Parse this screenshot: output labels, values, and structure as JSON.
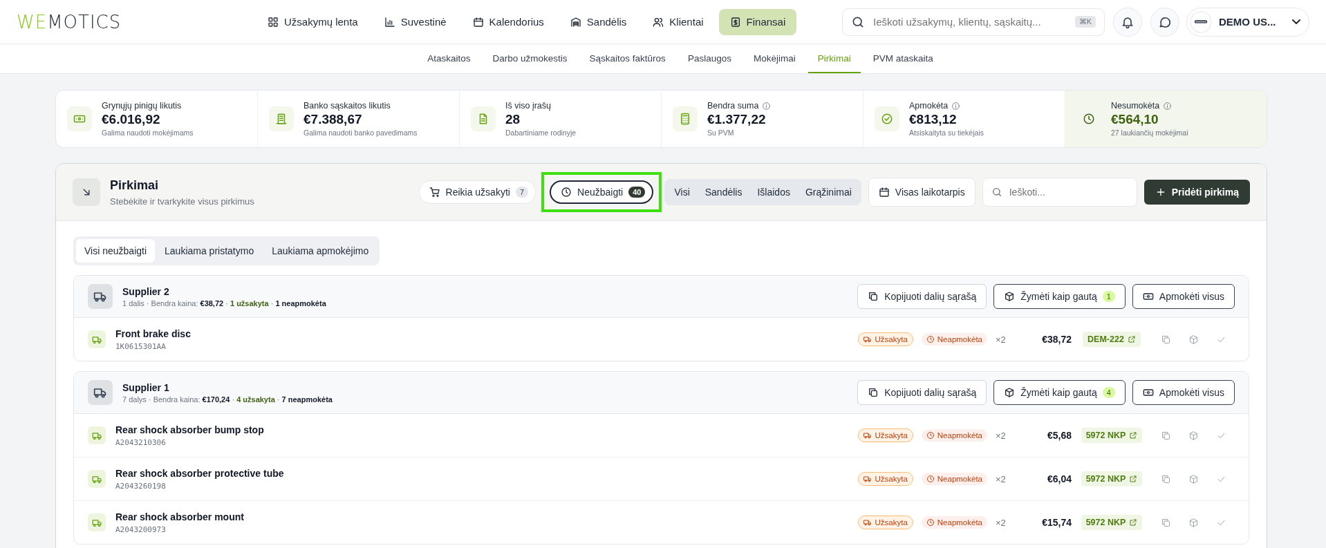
{
  "logo": {
    "accent": "WE",
    "rest": "MOTICS"
  },
  "nav": [
    {
      "label": "Užsakymų lenta",
      "selected": false
    },
    {
      "label": "Suvestinė",
      "selected": false
    },
    {
      "label": "Kalendorius",
      "selected": false
    },
    {
      "label": "Sandėlis",
      "selected": false
    },
    {
      "label": "Klientai",
      "selected": false
    },
    {
      "label": "Finansai",
      "selected": true
    }
  ],
  "search": {
    "placeholder": "Ieškoti užsakymų, klientų, sąskaitų...",
    "shortcut": "⌘K"
  },
  "user": {
    "name": "DEMO US..."
  },
  "subnav": [
    {
      "label": "Ataskaitos",
      "selected": false
    },
    {
      "label": "Darbo užmokestis",
      "selected": false
    },
    {
      "label": "Sąskaitos faktūros",
      "selected": false
    },
    {
      "label": "Paslaugos",
      "selected": false
    },
    {
      "label": "Mokėjimai",
      "selected": false
    },
    {
      "label": "Pirkimai",
      "selected": true
    },
    {
      "label": "PVM ataskaita",
      "selected": false
    }
  ],
  "stats": [
    {
      "label": "Grynųjų pinigų likutis",
      "info": false,
      "value": "€6.016,92",
      "note": "Galima naudoti mokėjimams",
      "accent": false
    },
    {
      "label": "Banko sąskaitos likutis",
      "info": false,
      "value": "€7.388,67",
      "note": "Galima naudoti banko pavedimams",
      "accent": false
    },
    {
      "label": "Iš viso įrašų",
      "info": false,
      "value": "28",
      "note": "Dabartiniame rodinyje",
      "accent": false
    },
    {
      "label": "Bendra suma",
      "info": true,
      "value": "€1.377,22",
      "note": "Su PVM",
      "accent": false
    },
    {
      "label": "Apmokėta",
      "info": true,
      "value": "€813,12",
      "note": "Atsiskaityta su tiekėjais",
      "accent": false
    },
    {
      "label": "Nesumokėta",
      "info": true,
      "value": "€564,10",
      "note": "27 laukiančių mokėjimai",
      "accent": true
    }
  ],
  "panel": {
    "title": "Pirkimai",
    "subtitle": "Stebėkite ir tvarkykite visus pirkimus",
    "quick_filters": [
      {
        "label": "Reikia užsakyti",
        "count": "7",
        "selected": false,
        "highlighted": false
      },
      {
        "label": "Neužbaigti",
        "count": "40",
        "selected": true,
        "highlighted": true
      }
    ],
    "type_filters": [
      {
        "label": "Visi",
        "selected": false
      },
      {
        "label": "Sandėlis",
        "selected": false
      },
      {
        "label": "Išlaidos",
        "selected": false
      },
      {
        "label": "Grąžinimai",
        "selected": false
      }
    ],
    "period": "Visas laikotarpis",
    "search_placeholder": "Ieškoti...",
    "add_button": "Pridėti pirkimą",
    "tabs": [
      {
        "label": "Visi neužbaigti",
        "selected": true
      },
      {
        "label": "Laukiama pristatymo",
        "selected": false
      },
      {
        "label": "Laukiama apmokėjimo",
        "selected": false
      }
    ]
  },
  "suppliers": [
    {
      "name": "Supplier 2",
      "meta": [
        {
          "kind": "plain",
          "text": "1 dalis · Bendra kaina: "
        },
        {
          "kind": "price",
          "text": "€38,72"
        },
        {
          "kind": "plain",
          "text": " · "
        },
        {
          "kind": "ordered",
          "text": "1 užsakyta"
        },
        {
          "kind": "plain",
          "text": " · "
        },
        {
          "kind": "unpaid",
          "text": "1 neapmokėta"
        }
      ],
      "copy_button": "Kopijuoti dalių sąrašą",
      "receive_button": "Žymėti kaip gautą",
      "receive_count": "1",
      "pay_button": "Apmokėti visus",
      "items": [
        {
          "name": "Front brake disc",
          "code": "1K0615301AA",
          "ordered": "Užsakyta",
          "unpaid": "Neapmokėta",
          "qty": "×2",
          "price": "€38,72",
          "ref": "DEM-222"
        }
      ]
    },
    {
      "name": "Supplier 1",
      "meta": [
        {
          "kind": "plain",
          "text": "7 dalys · Bendra kaina: "
        },
        {
          "kind": "price",
          "text": "€170,24"
        },
        {
          "kind": "plain",
          "text": " · "
        },
        {
          "kind": "ordered",
          "text": "4 užsakyta"
        },
        {
          "kind": "plain",
          "text": " · "
        },
        {
          "kind": "unpaid",
          "text": "7 neapmokėta"
        }
      ],
      "copy_button": "Kopijuoti dalių sąrašą",
      "receive_button": "Žymėti kaip gautą",
      "receive_count": "4",
      "pay_button": "Apmokėti visus",
      "items": [
        {
          "name": "Rear shock absorber bump stop",
          "code": "A2043210306",
          "ordered": "Užsakyta",
          "unpaid": "Neapmokėta",
          "qty": "×2",
          "price": "€5,68",
          "ref": "5972 NKP"
        },
        {
          "name": "Rear shock absorber protective tube",
          "code": "A2043260198",
          "ordered": "Užsakyta",
          "unpaid": "Neapmokėta",
          "qty": "×2",
          "price": "€6,04",
          "ref": "5972 NKP"
        },
        {
          "name": "Rear shock absorber mount",
          "code": "A2043200973",
          "ordered": "Užsakyta",
          "unpaid": "Neapmokėta",
          "qty": "×2",
          "price": "€15,74",
          "ref": "5972 NKP"
        }
      ]
    }
  ]
}
